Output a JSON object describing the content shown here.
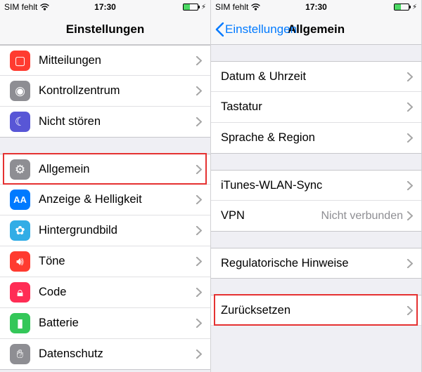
{
  "status": {
    "carrier": "SIM fehlt",
    "time": "17:30"
  },
  "left": {
    "title": "Einstellungen",
    "group1": [
      {
        "label": "Mitteilungen"
      },
      {
        "label": "Kontrollzentrum"
      },
      {
        "label": "Nicht stören"
      }
    ],
    "group2": [
      {
        "label": "Allgemein"
      },
      {
        "label": "Anzeige & Helligkeit"
      },
      {
        "label": "Hintergrundbild"
      },
      {
        "label": "Töne"
      },
      {
        "label": "Code"
      },
      {
        "label": "Batterie"
      },
      {
        "label": "Datenschutz"
      }
    ]
  },
  "right": {
    "back": "Einstellungen",
    "title": "Allgemein",
    "group1": [
      {
        "label": "Datum & Uhrzeit"
      },
      {
        "label": "Tastatur"
      },
      {
        "label": "Sprache & Region"
      }
    ],
    "group2": [
      {
        "label": "iTunes-WLAN-Sync"
      },
      {
        "label": "VPN",
        "value": "Nicht verbunden"
      }
    ],
    "group3": [
      {
        "label": "Regulatorische Hinweise"
      }
    ],
    "group4": [
      {
        "label": "Zurücksetzen"
      }
    ]
  }
}
